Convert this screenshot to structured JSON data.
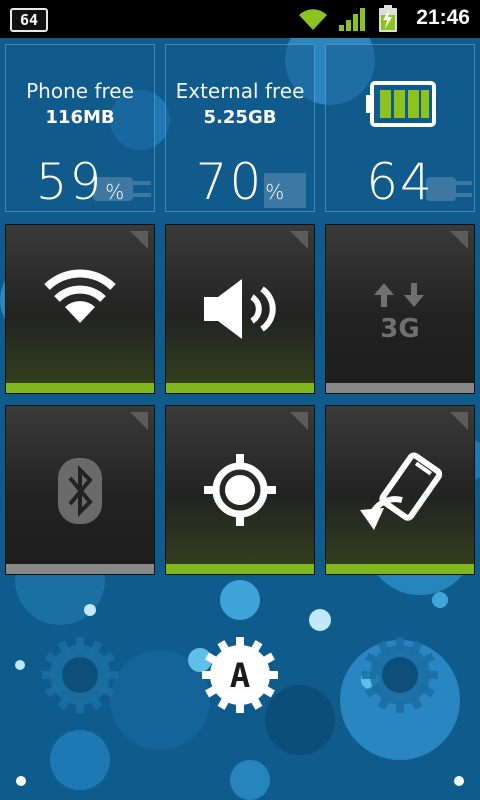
{
  "status_bar": {
    "battery_badge": "64",
    "time": "21:46",
    "icons": [
      "battery-number-icon",
      "wifi-icon",
      "signal-icon",
      "battery-charging-icon"
    ]
  },
  "info_tiles": [
    {
      "label": "Phone free",
      "value": "116MB",
      "percent": "59",
      "percent_sign": "%",
      "background_icon": "plug-icon"
    },
    {
      "label": "External free",
      "value": "5.25GB",
      "percent": "70",
      "percent_sign": "%",
      "background_icon": "sd-card-icon"
    },
    {
      "battery_level": "64",
      "icon": "battery-icon",
      "background_icon": "plug-icon"
    }
  ],
  "toggles": [
    {
      "name": "wifi",
      "icon": "wifi-icon",
      "state": "on"
    },
    {
      "name": "sound",
      "icon": "speaker-icon",
      "state": "on"
    },
    {
      "name": "mobile-data",
      "icon": "data-3g-icon",
      "icon_text": "3G",
      "state": "off"
    },
    {
      "name": "bluetooth",
      "icon": "bluetooth-icon",
      "state": "off"
    },
    {
      "name": "gps",
      "icon": "gps-icon",
      "state": "on"
    },
    {
      "name": "auto-rotate",
      "icon": "rotate-icon",
      "state": "on"
    }
  ],
  "dock": {
    "left_icon": "gear-icon",
    "center_icon": "app-launcher-icon",
    "center_letter": "A",
    "right_icon": "gear-icon"
  },
  "colors": {
    "accent_green": "#7fb71c",
    "off_gray": "#888888",
    "wallpaper_blue": "#0f5c8c",
    "battery_green": "#8dc21f"
  }
}
